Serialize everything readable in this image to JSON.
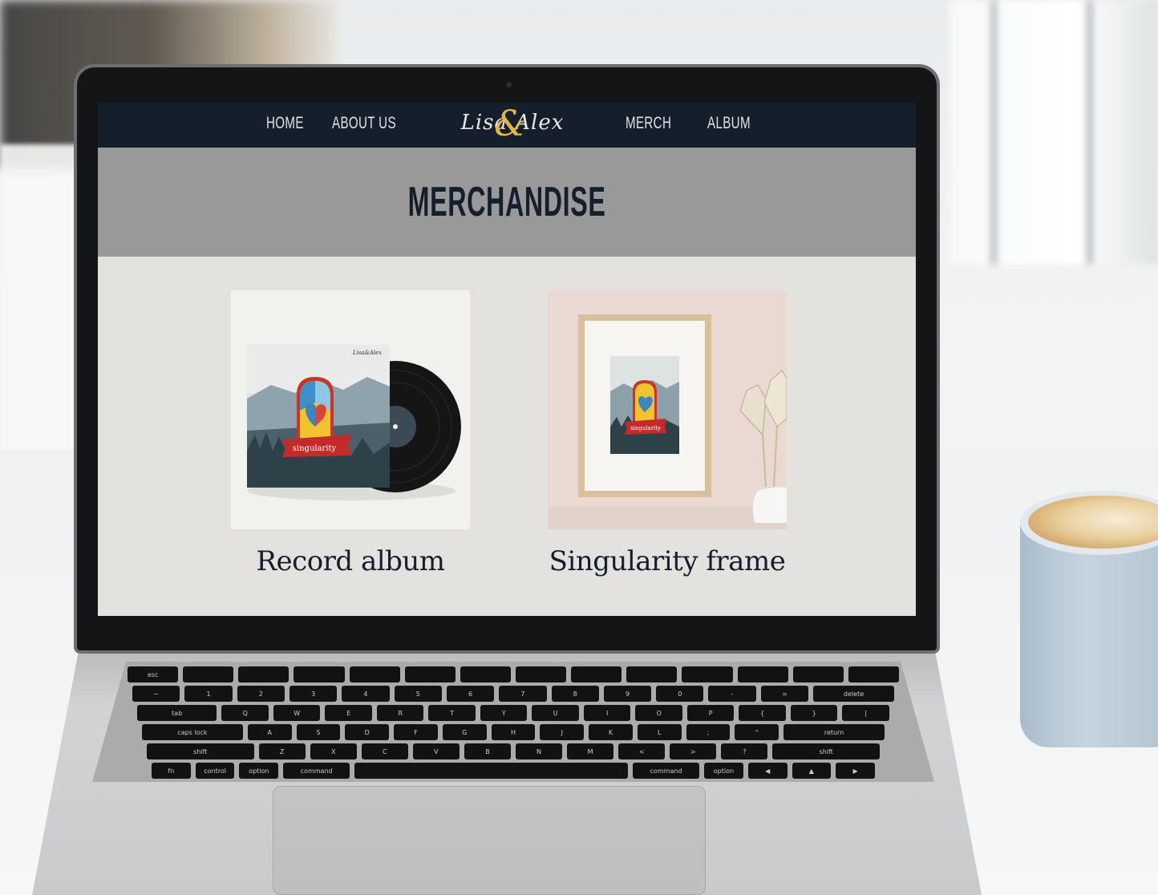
{
  "nav": {
    "links": [
      "HOME",
      "ABOUT US",
      "MERCH",
      "ALBUM"
    ],
    "logo_text": "Lisa Alex",
    "logo_amp": "&"
  },
  "page": {
    "title": "MERCHANDISE"
  },
  "products": [
    {
      "name": "Record album",
      "image": "vinyl-record-mockup",
      "cover_label": "singularity",
      "cover_brand": "Lisa&Alex"
    },
    {
      "name": "Singularity frame",
      "image": "framed-print-mockup",
      "cover_label": "singularity"
    }
  ],
  "colors": {
    "navbar": "#151e2b",
    "hero": "#999999",
    "content": "#e4e2de",
    "accent_gold": "#e5b54a",
    "text_dark": "#141e2c"
  }
}
